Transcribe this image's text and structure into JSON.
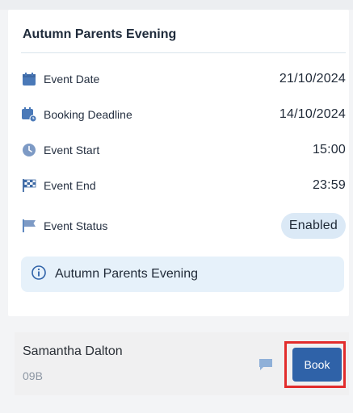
{
  "event": {
    "title": "Autumn Parents Evening",
    "rows": [
      {
        "icon": "calendar-icon",
        "label": "Event Date",
        "value": "21/10/2024"
      },
      {
        "icon": "calendar-clock-icon",
        "label": "Booking Deadline",
        "value": "14/10/2024"
      },
      {
        "icon": "clock-icon",
        "label": "Event Start",
        "value": "15:00"
      },
      {
        "icon": "checkered-flag-icon",
        "label": "Event End",
        "value": "23:59"
      },
      {
        "icon": "flag-icon",
        "label": "Event Status",
        "value": "Enabled"
      }
    ],
    "info": {
      "icon": "info-icon",
      "text": "Autumn Parents Evening"
    }
  },
  "teacher": {
    "name": "Samantha Dalton",
    "class": "09B",
    "message_icon": "chat-icon",
    "book_label": "Book"
  },
  "colors": {
    "accent": "#2f62a8",
    "icon_blue": "#4a79b8",
    "status_badge_bg": "#dbe9f6",
    "info_bg": "#e6f1fa",
    "highlight": "#e22c2c"
  }
}
